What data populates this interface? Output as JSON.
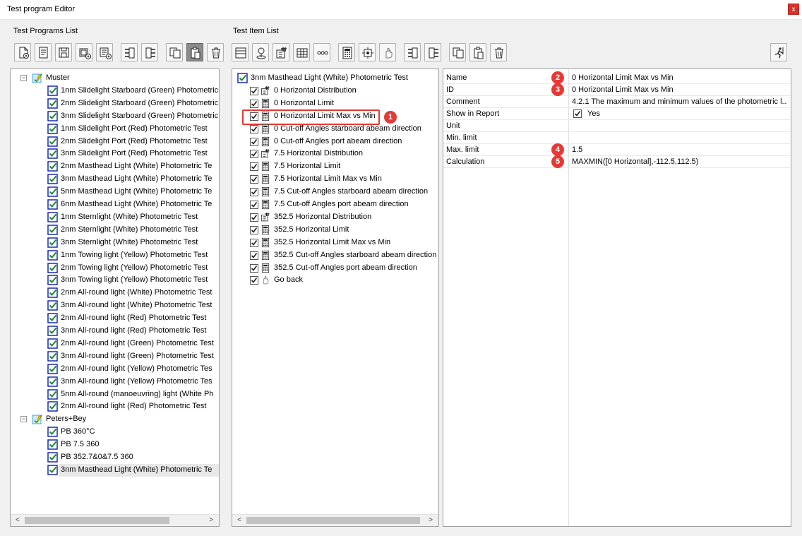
{
  "window": {
    "title": "Test program Editor",
    "close_label": "x"
  },
  "programs": {
    "group_label": "Test Programs List",
    "toolbar": [
      "new-program-icon",
      "program-info-icon",
      "save-icon",
      "add-group-icon",
      "add-item-icon",
      "move-up-icon",
      "move-down-icon",
      "copy-icon",
      "paste-icon",
      "delete-icon"
    ],
    "tree": [
      {
        "label": "Muster",
        "level": 0,
        "kind": "folder",
        "expander": "−"
      },
      {
        "label": "1nm Slidelight Starboard (Green) Photometric",
        "level": 1
      },
      {
        "label": "2nm Slidelight Starboard (Green) Photometric",
        "level": 1
      },
      {
        "label": "3nm Slidelight Starboard (Green) Photometric",
        "level": 1
      },
      {
        "label": "1nm Slidelight Port (Red) Photometric Test",
        "level": 1
      },
      {
        "label": "2nm Slidelight Port (Red) Photometric Test",
        "level": 1
      },
      {
        "label": "3nm Slidelight Port (Red) Photometric Test",
        "level": 1
      },
      {
        "label": "2nm Masthead Light (White) Photometric Te",
        "level": 1
      },
      {
        "label": "3nm Masthead Light (White) Photometric Te",
        "level": 1
      },
      {
        "label": "5nm Masthead Light (White) Photometric Te",
        "level": 1
      },
      {
        "label": "6nm Masthead Light (White) Photometric Te",
        "level": 1
      },
      {
        "label": "1nm Sternlight  (White) Photometric Test",
        "level": 1
      },
      {
        "label": "2nm Sternlight  (White) Photometric Test",
        "level": 1
      },
      {
        "label": "3nm Sternlight  (White) Photometric Test",
        "level": 1
      },
      {
        "label": "1nm Towing light (Yellow) Photometric Test",
        "level": 1
      },
      {
        "label": "2nm Towing light (Yellow) Photometric Test",
        "level": 1
      },
      {
        "label": "3nm Towing light (Yellow) Photometric Test",
        "level": 1
      },
      {
        "label": "2nm All-round light (White) Photometric Test",
        "level": 1
      },
      {
        "label": "3nm All-round light (White) Photometric Test",
        "level": 1
      },
      {
        "label": "2nm All-round light (Red) Photometric Test",
        "level": 1
      },
      {
        "label": "3nm All-round light (Red) Photometric Test",
        "level": 1
      },
      {
        "label": "2nm All-round light (Green) Photometric Test",
        "level": 1
      },
      {
        "label": "3nm All-round light (Green) Photometric Test",
        "level": 1
      },
      {
        "label": "2nm All-round light (Yellow) Photometric Tes",
        "level": 1
      },
      {
        "label": "3nm All-round light (Yellow) Photometric Tes",
        "level": 1
      },
      {
        "label": "5nm All-round (manoeuvring) light (White Ph",
        "level": 1
      },
      {
        "label": "2nm All-round light (Red) Photometric Test",
        "level": 1
      },
      {
        "label": "Peters+Bey",
        "level": 0,
        "kind": "folder",
        "expander": "−"
      },
      {
        "label": "PB 360°C",
        "level": 1
      },
      {
        "label": "PB 7.5 360",
        "level": 1
      },
      {
        "label": "PB 352.7&0&7.5  360",
        "level": 1
      },
      {
        "label": "3nm Masthead Light (White) Photometric Te",
        "level": 1,
        "selected": true
      }
    ],
    "scroll_left": "<",
    "scroll_right": ">"
  },
  "items": {
    "group_label": "Test Item List",
    "toolbar": [
      "item-list-icon",
      "location-icon",
      "distribution-icon",
      "table-icon",
      "dots-icon",
      "calculator-icon",
      "target-icon",
      "hand-icon",
      "move-up-icon",
      "move-down-icon",
      "copy-icon",
      "paste-icon",
      "delete-icon"
    ],
    "run_icon": "run-icon",
    "root": "3nm Masthead Light (White) Photometric Test",
    "list": [
      {
        "label": "0 Horizontal Distribution",
        "icon": "distribution-icon"
      },
      {
        "label": "0 Horizontal Limit",
        "icon": "calculator-icon"
      },
      {
        "label": "0 Horizontal Limit Max vs Min",
        "icon": "calculator-icon",
        "highlight": true
      },
      {
        "label": "0 Cut-off Angles starboard abeam direction",
        "icon": "calculator-icon"
      },
      {
        "label": "0 Cut-off Angles port abeam direction",
        "icon": "calculator-icon"
      },
      {
        "label": "7.5 Horizontal Distribution",
        "icon": "distribution-icon"
      },
      {
        "label": "7.5 Horizontal Limit",
        "icon": "calculator-icon"
      },
      {
        "label": "7.5 Horizontal Limit Max vs Min",
        "icon": "calculator-icon"
      },
      {
        "label": "7.5 Cut-off Angles starboard abeam direction",
        "icon": "calculator-icon"
      },
      {
        "label": "7.5 Cut-off Angles port abeam direction",
        "icon": "calculator-icon"
      },
      {
        "label": "352.5 Horizontal Distribution",
        "icon": "distribution-icon"
      },
      {
        "label": "352.5 Horizontal Limit",
        "icon": "calculator-icon"
      },
      {
        "label": "352.5 Horizontal Limit Max vs Min",
        "icon": "calculator-icon"
      },
      {
        "label": "352.5 Cut-off Angles starboard abeam direction",
        "icon": "calculator-icon"
      },
      {
        "label": "352.5 Cut-off Angles port abeam direction",
        "icon": "calculator-icon"
      },
      {
        "label": "Go back",
        "icon": "hand-icon"
      }
    ],
    "scroll_left": "<",
    "scroll_right": ">"
  },
  "properties": [
    {
      "name": "Name",
      "value": "0 Horizontal Limit Max vs Min",
      "badge": "2"
    },
    {
      "name": "ID",
      "value": "0 Horizontal Limit Max vs Min",
      "badge": "3"
    },
    {
      "name": "Comment",
      "value": "4.2.1 The maximum and minimum values of the photometric l..."
    },
    {
      "name": "Show in Report",
      "value": "Yes",
      "checkbox": true
    },
    {
      "name": "Unit",
      "value": ""
    },
    {
      "name": "Min. limit",
      "value": ""
    },
    {
      "name": "Max. limit",
      "value": "1.5",
      "badge": "4"
    },
    {
      "name": "Calculation",
      "value": "MAXMIN([0 Horizontal],-112.5,112.5)",
      "badge": "5"
    }
  ],
  "annotations": {
    "badge_1": "1"
  },
  "colors": {
    "annotation": "#e53935",
    "check": "#1d8a2b",
    "icon_frame": "#1a2bb0"
  }
}
